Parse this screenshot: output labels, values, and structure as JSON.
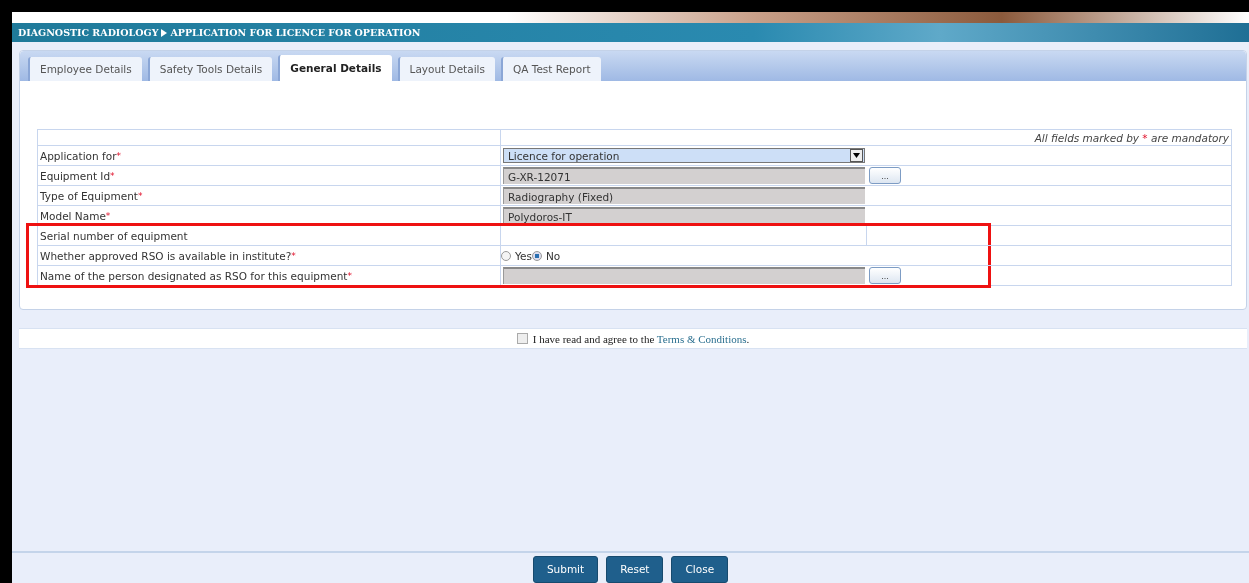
{
  "breadcrumb": {
    "section": "DIAGNOSTIC RADIOLOGY",
    "page": "APPLICATION FOR LICENCE FOR OPERATION"
  },
  "tabs": [
    {
      "label": "Employee Details",
      "selected": false
    },
    {
      "label": "Safety Tools Details",
      "selected": false
    },
    {
      "label": "General Details",
      "selected": true
    },
    {
      "label": "Layout Details",
      "selected": false
    },
    {
      "label": "QA Test Report",
      "selected": false
    }
  ],
  "mandatory_note": {
    "before": "All fields marked by",
    "mark": "*",
    "after": "are mandatory"
  },
  "rows": [
    {
      "label": "Application for",
      "required": true,
      "kind": "select",
      "value": "Licence for operation",
      "highlighted": false
    },
    {
      "label": "Equipment Id",
      "required": true,
      "kind": "lookup",
      "value": "G-XR-12071",
      "button": "...",
      "highlighted": false
    },
    {
      "label": "Type of Equipment",
      "required": true,
      "kind": "text",
      "value": "Radiography (Fixed)",
      "highlighted": false
    },
    {
      "label": "Model Name",
      "required": true,
      "kind": "text",
      "value": "Polydoros-IT",
      "highlighted": false
    },
    {
      "label": "Serial number of equipment",
      "required": false,
      "kind": "empty",
      "highlighted": true
    },
    {
      "label": "Whether approved RSO is available in institute?",
      "required": true,
      "kind": "radio",
      "options": [
        {
          "label": "Yes",
          "selected": false
        },
        {
          "label": "No",
          "selected": true
        }
      ],
      "highlighted": true
    },
    {
      "label": "Name of the person designated as RSO for this equipment",
      "required": true,
      "kind": "lookup",
      "button": "...",
      "highlighted": true
    }
  ],
  "agreement": {
    "checked": false,
    "text": "I have read and agree to the",
    "link": "Terms & Conditions",
    "end": "."
  },
  "buttons": [
    "Submit",
    "Reset",
    "Close"
  ]
}
